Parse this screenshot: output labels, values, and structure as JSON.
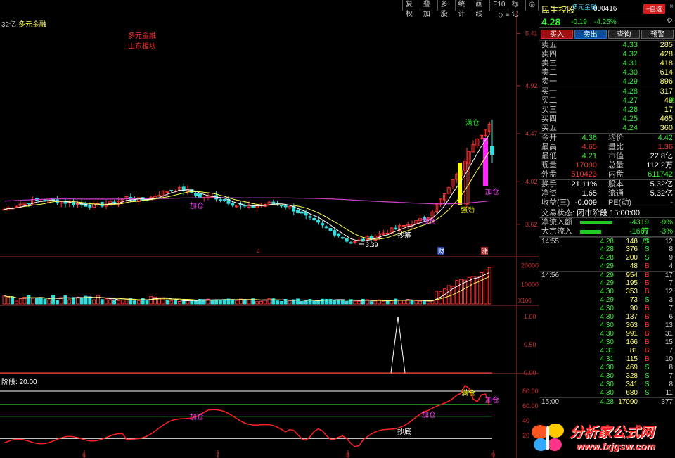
{
  "toolbar": [
    "复权",
    "叠加",
    "多股",
    "统计",
    "画线",
    "F10",
    "标记",
    "◎"
  ],
  "icons": {
    "window_controls": "◇ ≡"
  },
  "chart": {
    "title_prefix": "32亿",
    "title_name": "多元金融",
    "legend_lines": [
      "多元金融",
      "山东板块"
    ],
    "sub_title": "阶段: 20.00",
    "price_axis": [
      "5.41",
      "4.92",
      "4.47",
      "4.02",
      "3.62"
    ],
    "vol_axis": [
      "20000",
      "10000"
    ],
    "vol_unit": "X100",
    "ind_axis": [
      "1.00",
      "0.50",
      "0.00"
    ],
    "bot_axis": [
      "80.00",
      "60.00",
      "40",
      "20"
    ],
    "date_labels": [
      "6",
      "7",
      "8",
      "9"
    ],
    "low_label": "3.39",
    "annotations": {
      "buy_mark": "加仓",
      "buy_mark2": "加仓",
      "chip": "抄筹",
      "bottom": "抄底",
      "pos": "满仓",
      "drag": "强劲",
      "jiacang2": "加仓",
      "caifu": "财",
      "zhang": "涨",
      "four": "4",
      "bot_baocang": "满仓",
      "bot_jiacang": "加仓",
      "bot_jiacang2": "加仓",
      "bot_jiacang3": "加仓",
      "bot_chaodi": "抄底"
    }
  },
  "colors": {
    "up": "#ff3333",
    "down": "#33dddd",
    "ma_yellow": "#ffff55",
    "ma_purple": "#cc44cc",
    "green": "#33ee33"
  },
  "panel": {
    "name": "民生控股",
    "sub": "多元金融",
    "code": "000416",
    "add_btn": "+自选",
    "price": "4.28",
    "change": "-0.19",
    "pct": "-4.25%",
    "buttons": [
      "买入",
      "卖出",
      "查询",
      "预警"
    ],
    "sell_book": [
      {
        "l": "卖五",
        "p": "4.33",
        "v": "285"
      },
      {
        "l": "卖四",
        "p": "4.32",
        "v": "428"
      },
      {
        "l": "卖三",
        "p": "4.31",
        "v": "418"
      },
      {
        "l": "卖二",
        "p": "4.30",
        "v": "614"
      },
      {
        "l": "卖一",
        "p": "4.29",
        "v": "896"
      }
    ],
    "buy_book": [
      {
        "l": "买一",
        "p": "4.28",
        "v": "317"
      },
      {
        "l": "买二",
        "p": "4.27",
        "v": "49"
      },
      {
        "l": "买三",
        "p": "4.26",
        "v": "17"
      },
      {
        "l": "买四",
        "p": "4.25",
        "v": "465"
      },
      {
        "l": "买五",
        "p": "4.24",
        "v": "360"
      }
    ],
    "side_tag": "笔",
    "stats": [
      {
        "k1": "今开",
        "v1": "4.36",
        "c1": "#33ee33",
        "k2": "均价",
        "v2": "4.42",
        "c2": "#33ee33"
      },
      {
        "k1": "最高",
        "v1": "4.65",
        "c1": "#ff3333",
        "k2": "量比",
        "v2": "1.36",
        "c2": "#ff3333"
      },
      {
        "k1": "最低",
        "v1": "4.21",
        "c1": "#33ee33",
        "k2": "市值",
        "v2": "22.8亿",
        "c2": "#ffffff"
      },
      {
        "k1": "现量",
        "v1": "17090",
        "c1": "#ff3333",
        "k2": "总量",
        "v2": "112.2万",
        "c2": "#ffffff"
      },
      {
        "k1": "外盘",
        "v1": "510423",
        "c1": "#ff3333",
        "k2": "内盘",
        "v2": "611742",
        "c2": "#33ee33"
      }
    ],
    "stats2": [
      {
        "k1": "换手",
        "v1": "21.11%",
        "c1": "#ffffff",
        "k2": "股本",
        "v2": "5.32亿",
        "c2": "#ffffff"
      },
      {
        "k1": "净资",
        "v1": "1.65",
        "c1": "#ffffff",
        "k2": "流通",
        "v2": "5.32亿",
        "c2": "#ffffff"
      },
      {
        "k1": "收益(三)",
        "v1": "-0.009",
        "c1": "#ffffff",
        "k2": "PE(动)",
        "v2": "-",
        "c2": "#ffffff"
      }
    ],
    "state_label": "交易状态:",
    "state_value": "闭市阶段 15:00:00",
    "flows": [
      {
        "k": "净流入额",
        "bar": 46,
        "v": "-4319万",
        "p": "-9%"
      },
      {
        "k": "大宗流入",
        "bar": 30,
        "v": "-1667万",
        "p": "-3%"
      }
    ],
    "ticks": [
      {
        "t": "14:55",
        "pr": "4.28",
        "vo": "148",
        "bs": "S",
        "n": "12"
      },
      {
        "t": "",
        "pr": "4.28",
        "vo": "376",
        "bs": "S",
        "n": "8"
      },
      {
        "t": "",
        "pr": "4.28",
        "vo": "200",
        "bs": "S",
        "n": "9"
      },
      {
        "t": "",
        "pr": "4.29",
        "vo": "48",
        "bs": "B",
        "n": "4"
      },
      {
        "t": "14:56",
        "pr": "4.29",
        "vo": "954",
        "bs": "B",
        "n": "17"
      },
      {
        "t": "",
        "pr": "4.29",
        "vo": "195",
        "bs": "B",
        "n": "7"
      },
      {
        "t": "",
        "pr": "4.30",
        "vo": "353",
        "bs": "B",
        "n": "12"
      },
      {
        "t": "",
        "pr": "4.29",
        "vo": "73",
        "bs": "S",
        "n": "3"
      },
      {
        "t": "",
        "pr": "4.30",
        "vo": "90",
        "bs": "B",
        "n": "7"
      },
      {
        "t": "",
        "pr": "4.30",
        "vo": "137",
        "bs": "B",
        "n": "6"
      },
      {
        "t": "",
        "pr": "4.30",
        "vo": "363",
        "bs": "B",
        "n": "13"
      },
      {
        "t": "",
        "pr": "4.30",
        "vo": "991",
        "bs": "B",
        "n": "31"
      },
      {
        "t": "",
        "pr": "4.30",
        "vo": "166",
        "bs": "B",
        "n": "15"
      },
      {
        "t": "",
        "pr": "4.31",
        "vo": "81",
        "bs": "B",
        "n": "7"
      },
      {
        "t": "",
        "pr": "4.31",
        "vo": "115",
        "bs": "B",
        "n": "10"
      },
      {
        "t": "",
        "pr": "4.30",
        "vo": "469",
        "bs": "S",
        "n": "8"
      },
      {
        "t": "",
        "pr": "4.30",
        "vo": "328",
        "bs": "S",
        "n": "7"
      },
      {
        "t": "",
        "pr": "4.30",
        "vo": "341",
        "bs": "S",
        "n": "8"
      },
      {
        "t": "",
        "pr": "4.30",
        "vo": "680",
        "bs": "S",
        "n": "11"
      },
      {
        "t": "15:00",
        "pr": "4.28",
        "vo": "17090",
        "bs": "",
        "n": "377"
      }
    ]
  },
  "watermark": {
    "title": "分析家公式网",
    "url": "www.fxjgsw.com"
  }
}
